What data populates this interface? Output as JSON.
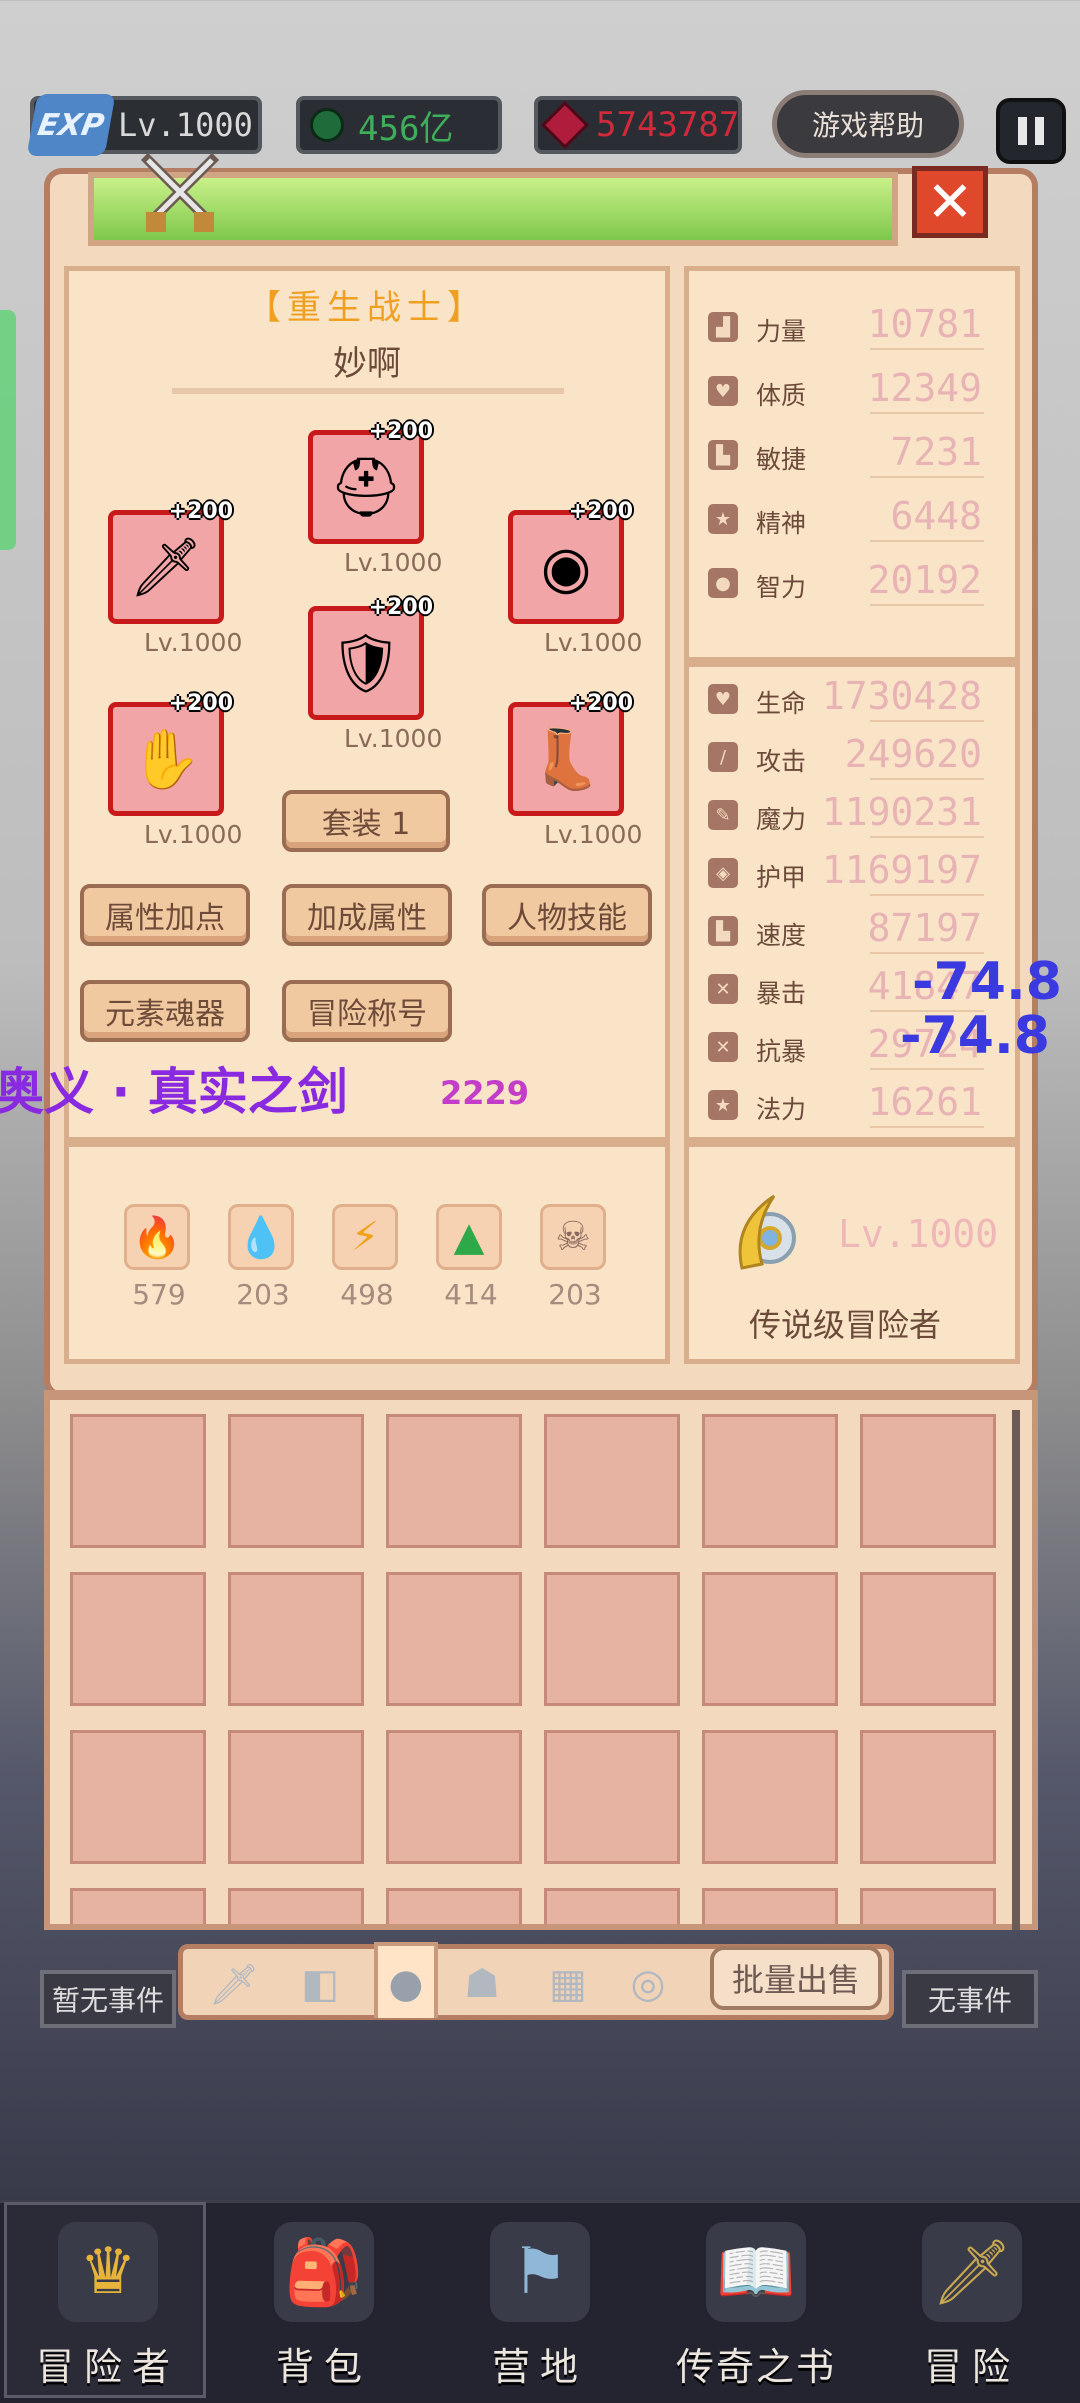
{
  "topbar": {
    "exp_label": "EXP",
    "level": "Lv.1000",
    "emerald": "456亿",
    "ruby": "5743787",
    "help_label": "游戏帮助",
    "emerald_color": "#3fae5a",
    "ruby_color": "#d12a3a"
  },
  "panel": {
    "class_name": "【重生战士】",
    "player_name": "妙啊",
    "equipment": [
      {
        "slot": "helmet",
        "plus": "+200",
        "level": "Lv.1000",
        "icon": "helmet-icon"
      },
      {
        "slot": "weapon",
        "plus": "+200",
        "level": "Lv.1000",
        "icon": "flame-sword-icon"
      },
      {
        "slot": "shield",
        "plus": "+200",
        "level": "Lv.1000",
        "icon": "round-shield-icon"
      },
      {
        "slot": "armor",
        "plus": "+200",
        "level": "Lv.1000",
        "icon": "armor-icon"
      },
      {
        "slot": "gloves",
        "plus": "+200",
        "level": "Lv.1000",
        "icon": "gloves-icon"
      },
      {
        "slot": "boots",
        "plus": "+200",
        "level": "Lv.1000",
        "icon": "boots-icon"
      }
    ],
    "set_label": "套装 1",
    "buttons": [
      "属性加点",
      "加成属性",
      "人物技能",
      "元素魂器",
      "冒险称号"
    ],
    "overlay_skill": "奥义 · 真实之剑",
    "overlay_number": "2229",
    "resources": [
      {
        "icon": "fire-element-icon",
        "value": "579"
      },
      {
        "icon": "water-element-icon",
        "value": "203"
      },
      {
        "icon": "lightning-element-icon",
        "value": "498"
      },
      {
        "icon": "earth-element-icon",
        "value": "414"
      },
      {
        "icon": "dark-element-icon",
        "value": "203"
      }
    ]
  },
  "attributes": [
    {
      "label": "力量",
      "value": "10781"
    },
    {
      "label": "体质",
      "value": "12349"
    },
    {
      "label": "敏捷",
      "value": "7231"
    },
    {
      "label": "精神",
      "value": "6448"
    },
    {
      "label": "智力",
      "value": "20192"
    }
  ],
  "combat_stats": [
    {
      "label": "生命",
      "value": "1730428"
    },
    {
      "label": "攻击",
      "value": "249620"
    },
    {
      "label": "魔力",
      "value": "1190231"
    },
    {
      "label": "护甲",
      "value": "1169197"
    },
    {
      "label": "速度",
      "value": "87197"
    },
    {
      "label": "暴击",
      "value": "41847"
    },
    {
      "label": "抗暴",
      "value": "29724"
    },
    {
      "label": "法力",
      "value": "16261"
    }
  ],
  "damage_floats": [
    "-74.8",
    "-74.8"
  ],
  "legend": {
    "level": "Lv.1000",
    "title": "传说级冒险者"
  },
  "inventory": {
    "tab_icons": [
      "sword-tab-icon",
      "armor-tab-icon",
      "helmet-tab-icon",
      "gloves-tab-icon",
      "boots-tab-icon",
      "ring-tab-icon"
    ],
    "sell_label": "批量出售",
    "left_event": "暂无事件",
    "right_event": "无事件"
  },
  "bottom_nav": [
    {
      "label": "冒险者",
      "icon": "crown-icon"
    },
    {
      "label": "背包",
      "icon": "backpack-icon"
    },
    {
      "label": "营地",
      "icon": "camp-icon"
    },
    {
      "label": "传奇之书",
      "icon": "book-icon"
    },
    {
      "label": "冒险",
      "icon": "sword-icon"
    }
  ]
}
